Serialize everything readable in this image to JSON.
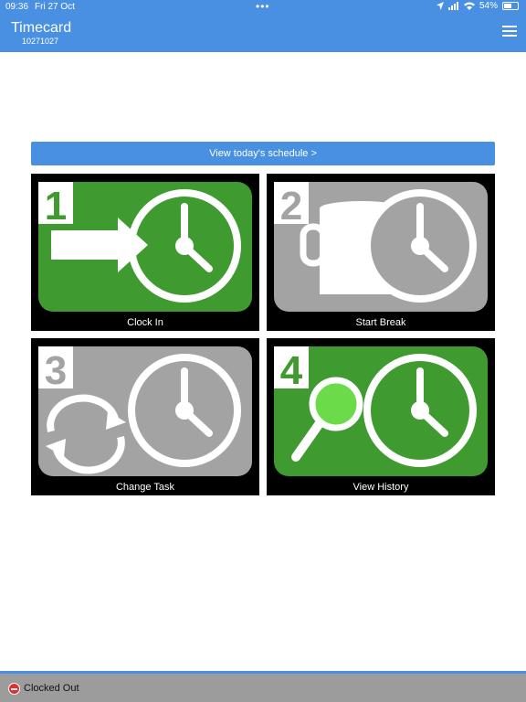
{
  "status_bar": {
    "time": "09:36",
    "date": "Fri 27 Oct",
    "dots": "•••",
    "battery": "54%",
    "battery_level": 0.54
  },
  "header": {
    "title": "Timecard",
    "subtitle": "10271027",
    "menu_icon": "hamburger-menu-icon"
  },
  "schedule_button": {
    "label": "View today's schedule >"
  },
  "tiles": [
    {
      "number": "1",
      "label": "Clock In",
      "icon": "clock-in-icon",
      "color": "#3f9a2f"
    },
    {
      "number": "2",
      "label": "Start Break",
      "icon": "coffee-cup-clock-icon",
      "color": "#a3a3a3"
    },
    {
      "number": "3",
      "label": "Change Task",
      "icon": "refresh-clock-icon",
      "color": "#a3a3a3"
    },
    {
      "number": "4",
      "label": "View History",
      "icon": "magnifier-clock-icon",
      "color": "#3f9a2f"
    }
  ],
  "footer": {
    "status_text": "Clocked Out",
    "status_icon": "stop-icon",
    "status_color": "#e03030"
  },
  "colors": {
    "accent": "#4a90e2",
    "green": "#3f9a2f",
    "grey": "#a3a3a3",
    "footer": "#9c9c9c"
  }
}
